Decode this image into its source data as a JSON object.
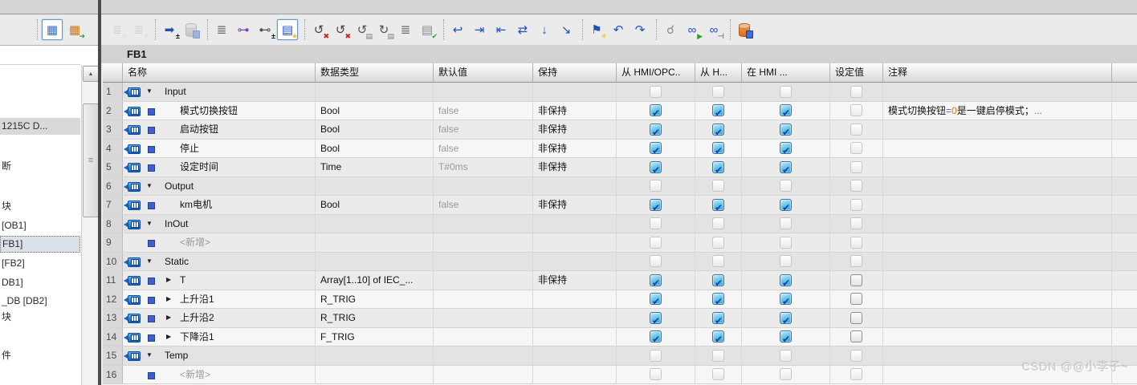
{
  "editor": {
    "block_title": "FB1"
  },
  "left_pane": {
    "toolbar": [
      {
        "name": "detail-view",
        "glyph": "▦",
        "color": "#3d6fb8",
        "boxed": true
      },
      {
        "name": "generate-block",
        "glyph": "▦",
        "color": "#c87820",
        "badge": "➜",
        "badge_color": "#2f9e2f"
      }
    ],
    "tree_items": [
      {
        "label": "1215C D...",
        "state": "highlight"
      },
      {
        "label": "断"
      },
      {
        "label": "块"
      },
      {
        "label": "[OB1]"
      },
      {
        "label": "FB1]",
        "state": "focused"
      },
      {
        "label": "[FB2]"
      },
      {
        "label": "DB1]"
      },
      {
        "label": "_DB [DB2]"
      },
      {
        "label": "块"
      },
      {
        "label": "件"
      }
    ],
    "scrollbar": {
      "up_glyph": "▲",
      "grip_glyph": "≡"
    }
  },
  "toolbar": {
    "items": [
      {
        "name": "insert-row",
        "glyph": "≣",
        "color": "#b3b3b3",
        "badge": "✳",
        "badge_color": "#c9c9c9",
        "disabled": true
      },
      {
        "name": "add-row",
        "glyph": "≣",
        "color": "#b3b3b3",
        "badge": "✳",
        "badge_color": "#c9c9c9",
        "disabled": true
      },
      {
        "sep": true
      },
      {
        "name": "expand-member-access",
        "glyph": "➡",
        "color": "#2050c0",
        "badge": "±",
        "badge_color": "#111111"
      },
      {
        "name": "keep-actual-values",
        "shape": "db-gray",
        "disabled": true
      },
      {
        "sep": true
      },
      {
        "name": "snapshot-actual-values",
        "glyph": "≣",
        "color": "#6a6a6a"
      },
      {
        "name": "copy-snapshots-to-start",
        "glyph": "⊶",
        "color": "#8040b8"
      },
      {
        "name": "copy-start-to-snapshot",
        "glyph": "⊷",
        "color": "#505050",
        "badge": "±",
        "badge_color": "#111111"
      },
      {
        "name": "update-interface",
        "glyph": "▤",
        "color": "#2050c0",
        "badge": "★",
        "badge_color": "#f0c020",
        "boxed": true
      },
      {
        "sep": true
      },
      {
        "name": "discard-snapshot-1",
        "glyph": "↺",
        "color": "#404040",
        "badge": "✖",
        "badge_color": "#d02020"
      },
      {
        "name": "discard-snapshot-2",
        "glyph": "↺",
        "color": "#404040",
        "badge": "✖",
        "badge_color": "#d02020"
      },
      {
        "name": "apply-to-start-1",
        "glyph": "↺",
        "color": "#505050",
        "badge": "▤",
        "badge_color": "#7a7a7a"
      },
      {
        "name": "apply-to-start-2",
        "glyph": "↻",
        "color": "#505050",
        "badge": "▤",
        "badge_color": "#7a7a7a"
      },
      {
        "name": "compare-values",
        "glyph": "≣",
        "color": "#6a6a6a"
      },
      {
        "name": "consistency-check",
        "glyph": "▤",
        "color": "#8a8a8a",
        "badge": "✔",
        "badge_color": "#2f9e2f"
      },
      {
        "sep": true
      },
      {
        "name": "goto-definition",
        "glyph": "↩",
        "color": "#2050c0"
      },
      {
        "name": "forward-to",
        "glyph": "⇥",
        "color": "#2050c0"
      },
      {
        "name": "back-to",
        "glyph": "⇤",
        "color": "#2050c0"
      },
      {
        "name": "rewire",
        "glyph": "⇄",
        "color": "#2050c0"
      },
      {
        "name": "sort-order",
        "glyph": "↓",
        "color": "#2050c0"
      },
      {
        "name": "cross-reference",
        "glyph": "↘",
        "color": "#2050c0"
      },
      {
        "sep": true
      },
      {
        "name": "insert-bookmark",
        "glyph": "⚑",
        "color": "#2050c0",
        "badge": "✳",
        "badge_color": "#e8c020"
      },
      {
        "name": "previous-bookmark",
        "glyph": "↶",
        "color": "#2050c0"
      },
      {
        "name": "next-bookmark",
        "glyph": "↷",
        "color": "#2050c0"
      },
      {
        "sep": true
      },
      {
        "name": "go-online-search",
        "glyph": "☌",
        "color": "#8a8a8a"
      },
      {
        "name": "monitor-all",
        "glyph": "∞",
        "color": "#2050c0",
        "badge": "▶",
        "badge_color": "#2f9e2f"
      },
      {
        "name": "monitor-snapshot",
        "glyph": "∞",
        "color": "#2050c0",
        "badge": "⊣",
        "badge_color": "#7a7a7a"
      },
      {
        "sep": true
      },
      {
        "name": "snapshot-db",
        "shape": "db-orange"
      }
    ]
  },
  "table": {
    "headers": {
      "name": "名称",
      "datatype": "数据类型",
      "default": "默认值",
      "retain": "保持",
      "hmi_opc": "从 HMI/OPC..",
      "from_h": "从 H...",
      "in_hmi": "在 HMI ...",
      "setpoint": "设定值",
      "comment": "注释"
    },
    "rows": [
      {
        "num": "1",
        "kind": "section",
        "name": "Input",
        "datatype": "",
        "default": "",
        "retain": "",
        "cb": [
          "dis",
          "dis",
          "dis",
          "dis"
        ]
      },
      {
        "num": "2",
        "kind": "member",
        "name": "模式切换按钮",
        "datatype": "Bool",
        "default": "false",
        "retain": "非保持",
        "cb": [
          "on",
          "on",
          "on",
          "dis"
        ],
        "comment": {
          "pre": "模式切换按钮",
          "eq": "=",
          "zero": "0",
          "post": "是一键启停模式；",
          "more": "..."
        }
      },
      {
        "num": "3",
        "kind": "member",
        "name": "启动按钮",
        "datatype": "Bool",
        "default": "false",
        "retain": "非保持",
        "cb": [
          "on",
          "on",
          "on",
          "dis"
        ]
      },
      {
        "num": "4",
        "kind": "member",
        "name": "停止",
        "datatype": "Bool",
        "default": "false",
        "retain": "非保持",
        "cb": [
          "on",
          "on",
          "on",
          "dis"
        ]
      },
      {
        "num": "5",
        "kind": "member",
        "name": "设定时间",
        "datatype": "Time",
        "default": "T#0ms",
        "retain": "非保持",
        "cb": [
          "on",
          "on",
          "on",
          "dis"
        ]
      },
      {
        "num": "6",
        "kind": "section",
        "name": "Output",
        "datatype": "",
        "default": "",
        "retain": "",
        "cb": [
          "dis",
          "dis",
          "dis",
          "dis"
        ]
      },
      {
        "num": "7",
        "kind": "member",
        "name": "km电机",
        "datatype": "Bool",
        "default": "false",
        "retain": "非保持",
        "cb": [
          "on",
          "on",
          "on",
          "dis"
        ]
      },
      {
        "num": "8",
        "kind": "section",
        "name": "InOut",
        "datatype": "",
        "default": "",
        "retain": "",
        "cb": [
          "dis",
          "dis",
          "dis",
          "dis"
        ]
      },
      {
        "num": "9",
        "kind": "add",
        "name": "<新增>",
        "datatype": "",
        "default": "",
        "retain": "",
        "cb": [
          "dis",
          "dis",
          "dis",
          "dis"
        ]
      },
      {
        "num": "10",
        "kind": "section",
        "name": "Static",
        "datatype": "",
        "default": "",
        "retain": "",
        "cb": [
          "dis",
          "dis",
          "dis",
          "dis"
        ]
      },
      {
        "num": "11",
        "kind": "struct",
        "name": "T",
        "datatype": "Array[1..10] of IEC_...",
        "default": "",
        "retain": "非保持",
        "cb": [
          "on",
          "on",
          "on",
          "off"
        ]
      },
      {
        "num": "12",
        "kind": "struct",
        "name": "上升沿1",
        "datatype": "R_TRIG",
        "default": "",
        "retain": "",
        "cb": [
          "on",
          "on",
          "on",
          "off"
        ]
      },
      {
        "num": "13",
        "kind": "struct",
        "name": "上升沿2",
        "datatype": "R_TRIG",
        "default": "",
        "retain": "",
        "cb": [
          "on",
          "on",
          "on",
          "off"
        ]
      },
      {
        "num": "14",
        "kind": "struct",
        "name": "下降沿1",
        "datatype": "F_TRIG",
        "default": "",
        "retain": "",
        "cb": [
          "on",
          "on",
          "on",
          "off"
        ]
      },
      {
        "num": "15",
        "kind": "section",
        "name": "Temp",
        "datatype": "",
        "default": "",
        "retain": "",
        "cb": [
          "dis",
          "dis",
          "dis",
          "dis"
        ]
      },
      {
        "num": "16",
        "kind": "add",
        "name": "<新增>",
        "datatype": "",
        "default": "",
        "retain": "",
        "cb": [
          "dis",
          "dis",
          "dis",
          "dis"
        ]
      }
    ]
  },
  "watermark": "CSDN @@小李子~",
  "colors": {
    "accent_blue": "#1565c0",
    "check_fill": "#35aede",
    "check_mark": "#1b3f9e",
    "comment_eq": "#3a6fc8",
    "comment_zero": "#e07818",
    "muted_text": "#9a9a9a"
  }
}
